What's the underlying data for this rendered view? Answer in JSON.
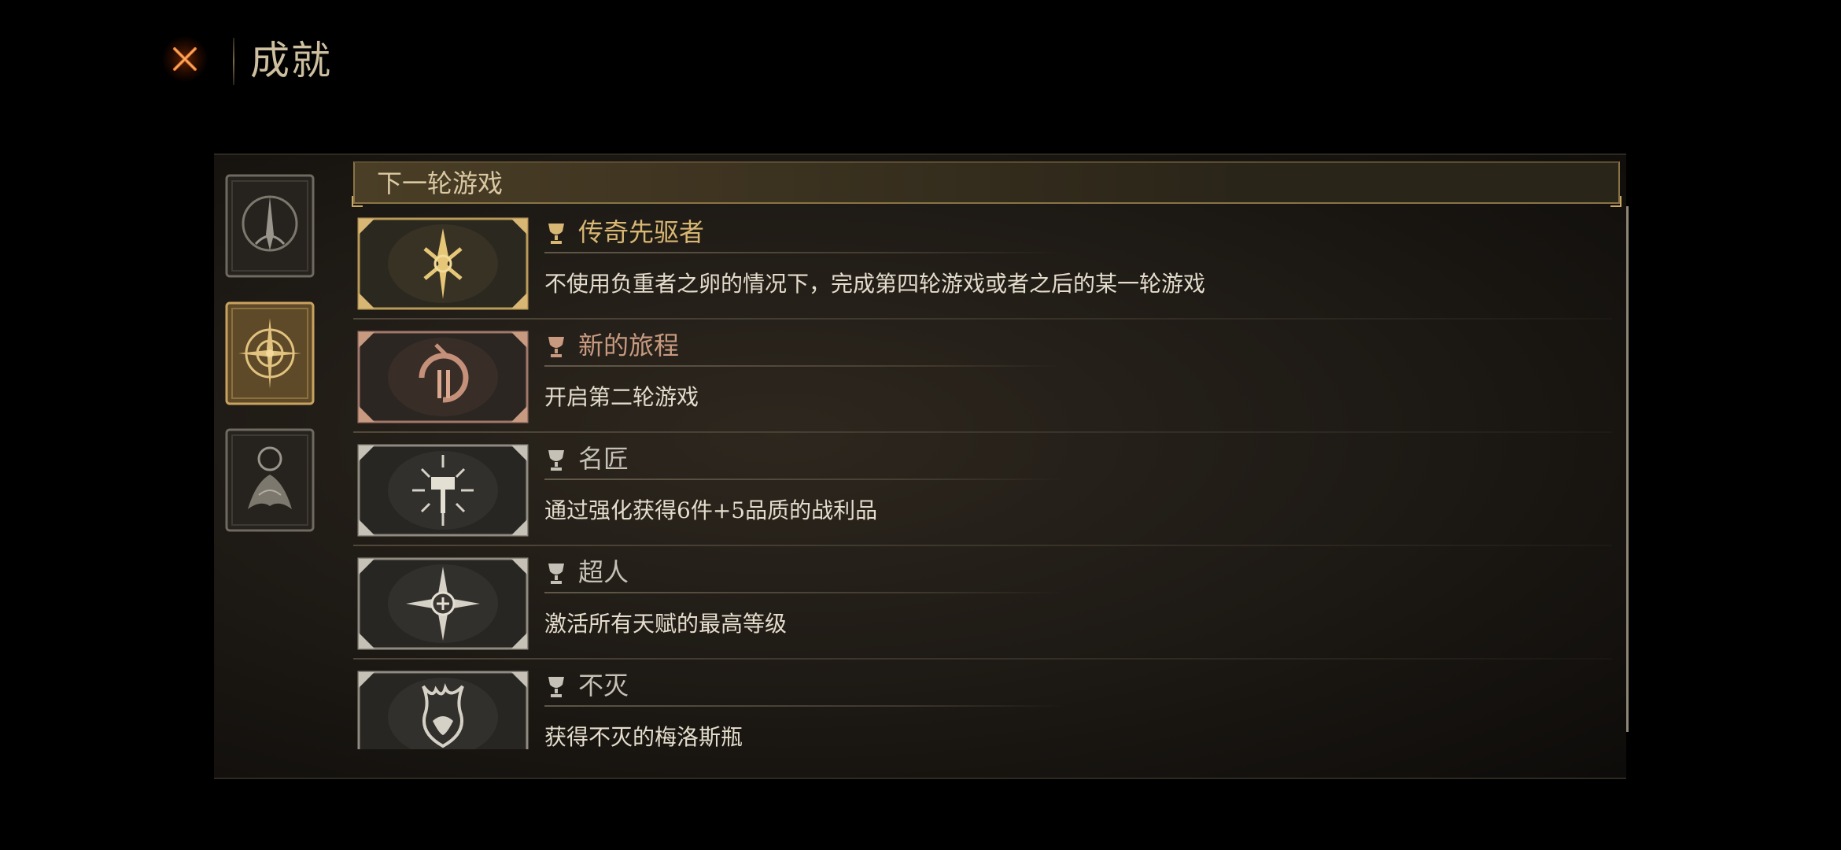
{
  "header": {
    "title": "成就",
    "close_icon": "close-x-icon"
  },
  "categories": [
    {
      "icon": "spire-emblem-icon",
      "selected": false,
      "color": "#9a958c"
    },
    {
      "icon": "compass-sun-emblem-icon",
      "selected": true,
      "color": "#d8b673"
    },
    {
      "icon": "ring-flame-emblem-icon",
      "selected": false,
      "color": "#9a958c"
    }
  ],
  "section": {
    "label": "下一轮游戏"
  },
  "achievements": [
    {
      "title": "传奇先驱者",
      "desc": "不使用负重者之卵的情况下，完成第四轮游戏或者之后的某一轮游戏",
      "tier": "gold",
      "icon": "sword-rune-icon",
      "color": "#d8b673"
    },
    {
      "title": "新的旅程",
      "desc": "开启第二轮游戏",
      "tier": "bronze",
      "icon": "cycle-ii-icon",
      "color": "#c89a80"
    },
    {
      "title": "名匠",
      "desc": "通过强化获得6件+5品质的战利品",
      "tier": "silver",
      "icon": "hammer-burst-icon",
      "color": "#c6c1b6"
    },
    {
      "title": "超人",
      "desc": "激活所有天赋的最高等级",
      "tier": "silver",
      "icon": "star-shield-icon",
      "color": "#c6c1b6"
    },
    {
      "title": "不灭",
      "desc": "获得不灭的梅洛斯瓶",
      "tier": "silver",
      "icon": "flame-flask-icon",
      "color": "#c6c1b6"
    }
  ]
}
